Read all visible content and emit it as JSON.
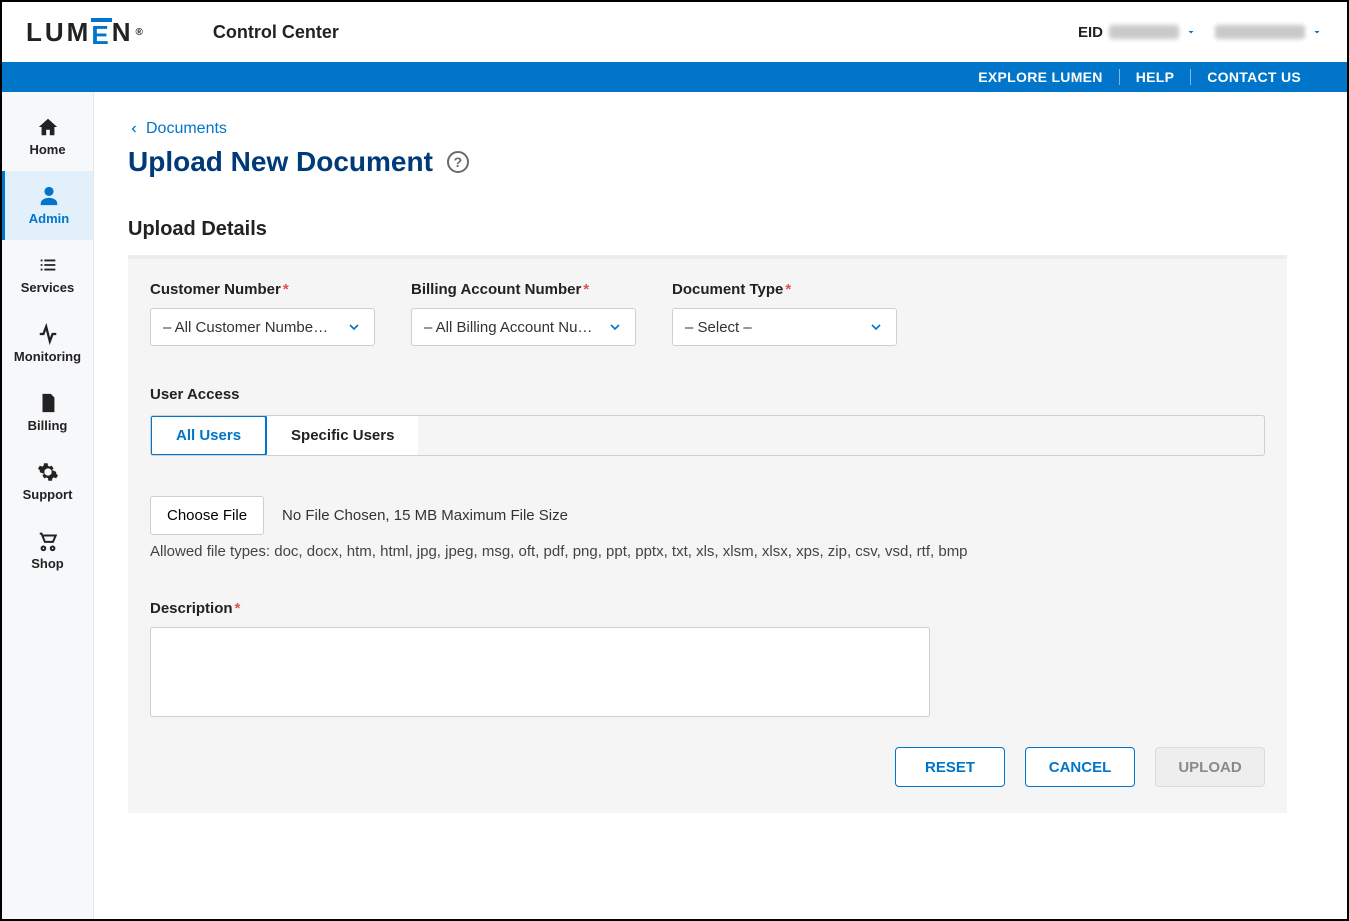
{
  "header": {
    "app_title": "Control Center",
    "eid_label": "EID",
    "logo_text_parts": {
      "l": "L",
      "u": "U",
      "m": "M",
      "e": "E",
      "n": "N"
    },
    "logo_reg": "®"
  },
  "bluebar": {
    "explore": "EXPLORE LUMEN",
    "help": "HELP",
    "contact": "CONTACT US"
  },
  "sidebar": [
    {
      "key": "home",
      "label": "Home"
    },
    {
      "key": "admin",
      "label": "Admin"
    },
    {
      "key": "services",
      "label": "Services"
    },
    {
      "key": "monitoring",
      "label": "Monitoring"
    },
    {
      "key": "billing",
      "label": "Billing"
    },
    {
      "key": "support",
      "label": "Support"
    },
    {
      "key": "shop",
      "label": "Shop"
    }
  ],
  "breadcrumb": {
    "back_label": "Documents"
  },
  "page": {
    "title": "Upload New Document"
  },
  "section": {
    "upload_details": "Upload Details"
  },
  "fields": {
    "customer_number": {
      "label": "Customer Number",
      "value": "– All Customer Numbers –"
    },
    "billing_account": {
      "label": "Billing Account Number",
      "value": "– All Billing Account Numb…"
    },
    "document_type": {
      "label": "Document Type",
      "value": "– Select –"
    },
    "user_access": {
      "label": "User Access",
      "options": {
        "all": "All Users",
        "specific": "Specific Users"
      }
    },
    "file": {
      "choose_label": "Choose File",
      "status": "No File Chosen, 15 MB Maximum File Size",
      "hint": "Allowed file types: doc, docx, htm, html, jpg, jpeg, msg, oft, pdf, png, ppt, pptx, txt, xls, xlsm, xlsx, xps, zip, csv, vsd, rtf, bmp"
    },
    "description": {
      "label": "Description",
      "value": ""
    }
  },
  "buttons": {
    "reset": "RESET",
    "cancel": "CANCEL",
    "upload": "UPLOAD"
  }
}
